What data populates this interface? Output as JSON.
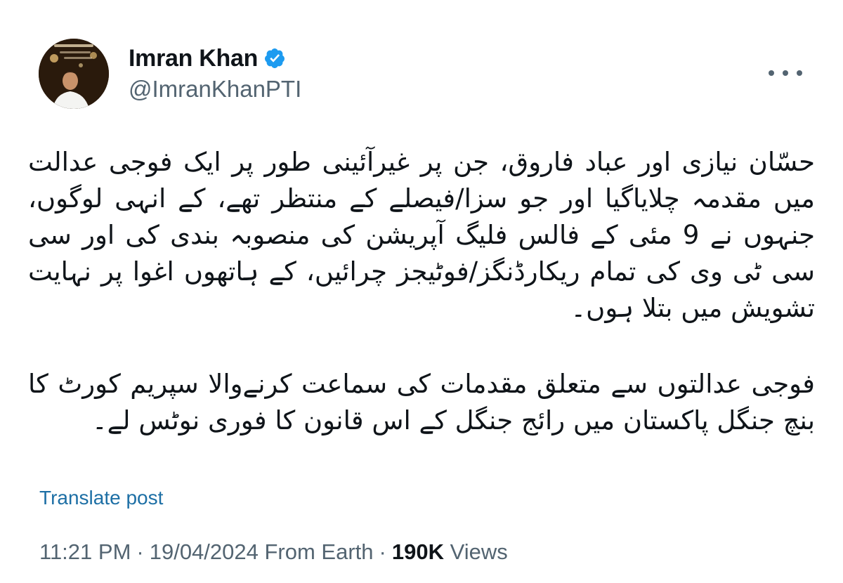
{
  "author": {
    "display_name": "Imran Khan",
    "handle": "@ImranKhanPTI",
    "verified": true,
    "verified_color": "#1d9bf0"
  },
  "tweet": {
    "paragraphs": [
      "حسّان نیازی اور عباد فاروق، جن پر غیرآئینی طور پر ایک فوجی عدالت میں مقدمہ چلایاگیا اور جو سزا/فیصلے کے منتظر تھے، کے انہی لوگوں، جنہوں نے 9 مئی کے فالس فلیگ آپریشن کی منصوبہ بندی کی اور سی سی ٹی وی کی تمام ریکارڈنگز/فوٹیجز چرائیں، کے ہاتھوں اغوا پر نہایت تشویش میں بتلا ہوں۔",
      "فوجی عدالتوں سے متعلق مقدمات کی سماعت کرنےوالا سپریم کورٹ کا بنچ جنگل پاکستان میں رائج جنگل کے اس قانون کا فوری نوٹس لے۔"
    ]
  },
  "actions": {
    "translate_label": "Translate post",
    "more_icon": "more-horizontal-icon"
  },
  "meta": {
    "time": "11:21 PM",
    "date": "19/04/2024",
    "source": "From Earth",
    "separator": "·",
    "views_count": "190K",
    "views_label": "Views"
  },
  "colors": {
    "text": "#0f1419",
    "secondary": "#536471",
    "link": "#1d6fa5"
  }
}
